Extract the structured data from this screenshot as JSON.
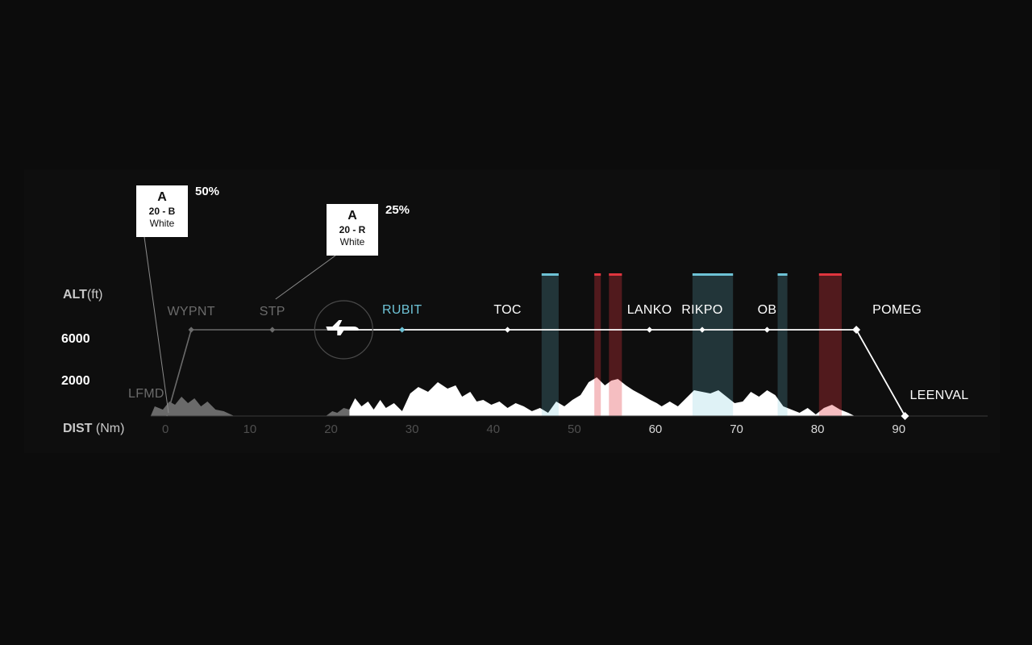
{
  "axes": {
    "alt_title_bold": "ALT",
    "alt_title_unit": "(ft)",
    "dist_title_bold": "DIST",
    "dist_title_unit": "(Nm)",
    "alt_values": [
      "6000",
      "2000"
    ],
    "dist_ticks": [
      "0",
      "10",
      "20",
      "30",
      "40",
      "50",
      "60",
      "70",
      "80",
      "90"
    ]
  },
  "waypoints": [
    {
      "name": "LFMD",
      "dist": 0,
      "state": "past"
    },
    {
      "name": "WYPNT",
      "dist": 3,
      "state": "past"
    },
    {
      "name": "STP",
      "dist": 13,
      "state": "past"
    },
    {
      "name": "RUBIT",
      "dist": 29,
      "state": "next"
    },
    {
      "name": "TOC",
      "dist": 42,
      "state": "future"
    },
    {
      "name": "LANKO",
      "dist": 59.5,
      "state": "future"
    },
    {
      "name": "RIKPO",
      "dist": 66,
      "state": "future"
    },
    {
      "name": "OB",
      "dist": 74,
      "state": "future"
    },
    {
      "name": "POMEG",
      "dist": 85,
      "state": "future"
    },
    {
      "name": "LEENVAL",
      "dist": 91,
      "state": "future"
    }
  ],
  "aircraft": {
    "icon": "airplane-icon",
    "dist": 22
  },
  "cards": [
    {
      "line1": "A",
      "line2": "20 - B",
      "line3": "White",
      "percent": "50%"
    },
    {
      "line1": "A",
      "line2": "20 - R",
      "line3": "White",
      "percent": "25%"
    }
  ],
  "zones": [
    {
      "type": "cyan",
      "from": 46.2,
      "to": 48.3
    },
    {
      "type": "red",
      "from": 52.7,
      "to": 53.5
    },
    {
      "type": "red",
      "from": 54.5,
      "to": 56.1
    },
    {
      "type": "cyan",
      "from": 64.8,
      "to": 69.8
    },
    {
      "type": "cyan",
      "from": 75.3,
      "to": 76.5
    },
    {
      "type": "red",
      "from": 80.4,
      "to": 83.2
    }
  ],
  "colors": {
    "background": "#0c0c0c",
    "panel": "#0e0e0e",
    "active": "#ffffff",
    "past": "#6b6b6b",
    "next": "#6ec3d6",
    "cyan_zone": "#6ec3d6",
    "red_zone": "#e0353e",
    "terrain_past": "#6a6a6a",
    "terrain_future": "#ffffff"
  }
}
